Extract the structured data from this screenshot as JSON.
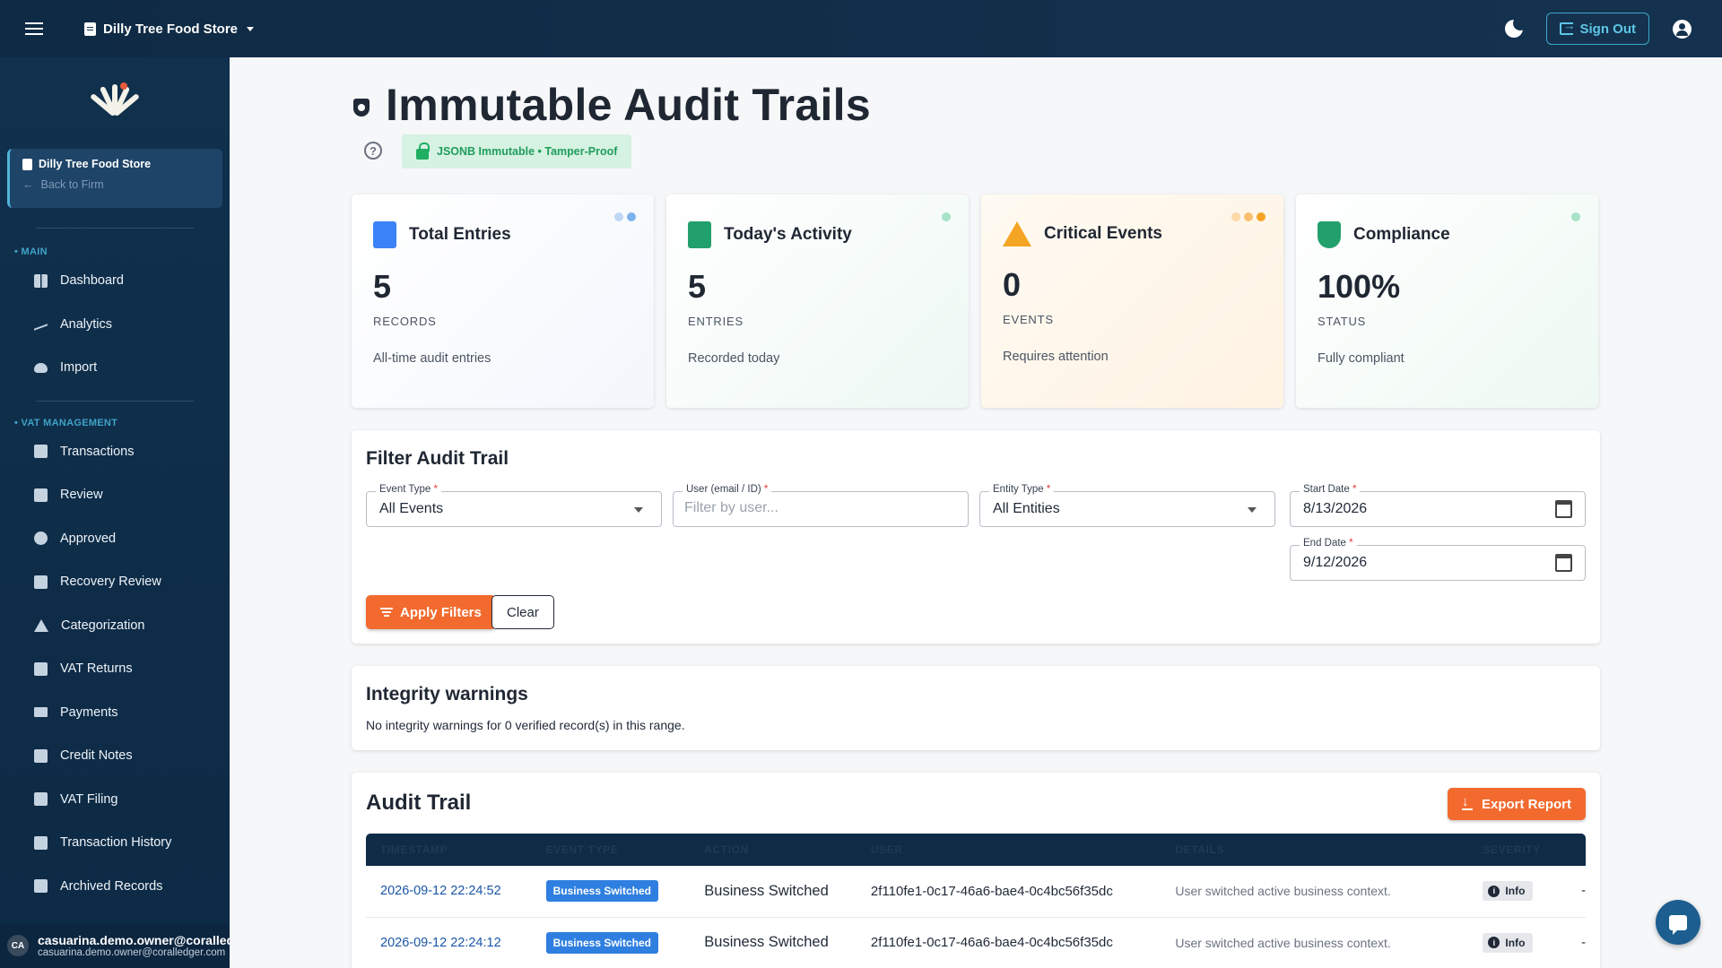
{
  "topbar": {
    "store_name": "Dilly Tree Food Store",
    "sign_out_label": "Sign Out"
  },
  "sidebar": {
    "store_card": {
      "name": "Dilly Tree Food Store",
      "back_label": "Back to Firm"
    },
    "sections": [
      {
        "label": "MAIN",
        "items": [
          "Dashboard",
          "Analytics",
          "Import"
        ]
      },
      {
        "label": "VAT MANAGEMENT",
        "items": [
          "Transactions",
          "Review",
          "Approved",
          "Recovery Review",
          "Categorization",
          "VAT Returns",
          "Payments",
          "Credit Notes",
          "VAT Filing",
          "Transaction History",
          "Archived Records"
        ]
      }
    ],
    "user": {
      "initials": "CA",
      "name": "casuarina.demo.owner@coralledger.com",
      "email": "casuarina.demo.owner@coralledger.com"
    }
  },
  "page": {
    "title": "Immutable Audit Trails",
    "badge": "JSONB Immutable • Tamper-Proof"
  },
  "stats": [
    {
      "title": "Total Entries",
      "value": "5",
      "unit": "RECORDS",
      "sub": "All-time audit entries",
      "icon": "document-icon",
      "color": "#3b82f6"
    },
    {
      "title": "Today's Activity",
      "value": "5",
      "unit": "ENTRIES",
      "sub": "Recorded today",
      "icon": "calendar-icon",
      "color": "#22a06b"
    },
    {
      "title": "Critical Events",
      "value": "0",
      "unit": "EVENTS",
      "sub": "Requires attention",
      "icon": "warning-icon",
      "color": "#f5a524"
    },
    {
      "title": "Compliance",
      "value": "100%",
      "unit": "STATUS",
      "sub": "Fully compliant",
      "icon": "shield-check-icon",
      "color": "#22a06b"
    }
  ],
  "filter": {
    "title": "Filter Audit Trail",
    "event_type": {
      "label": "Event Type",
      "value": "All Events"
    },
    "user": {
      "label": "User (email / ID)",
      "placeholder": "Filter by user..."
    },
    "entity_type": {
      "label": "Entity Type",
      "value": "All Entities"
    },
    "start_date": {
      "label": "Start Date",
      "value": "8/13/2026"
    },
    "end_date": {
      "label": "End Date",
      "value": "9/12/2026"
    },
    "apply_label": "Apply Filters",
    "clear_label": "Clear"
  },
  "integrity": {
    "title": "Integrity warnings",
    "message": "No integrity warnings for 0 verified record(s) in this range."
  },
  "audit": {
    "title": "Audit Trail",
    "export_label": "Export Report",
    "columns": [
      "TIMESTAMP",
      "EVENT TYPE",
      "ACTION",
      "USER",
      "DETAILS",
      "SEVERITY"
    ],
    "rows": [
      {
        "timestamp": "2026-09-12 22:24:52",
        "event_type": "Business Switched",
        "action": "Business Switched",
        "user": "2f110fe1-0c17-46a6-bae4-0c4bc56f35dc",
        "details": "User switched active business context.",
        "severity": "Info",
        "extra": "-"
      },
      {
        "timestamp": "2026-09-12 22:24:12",
        "event_type": "Business Switched",
        "action": "Business Switched",
        "user": "2f110fe1-0c17-46a6-bae4-0c4bc56f35dc",
        "details": "User switched active business context.",
        "severity": "Info",
        "extra": "-"
      }
    ]
  }
}
